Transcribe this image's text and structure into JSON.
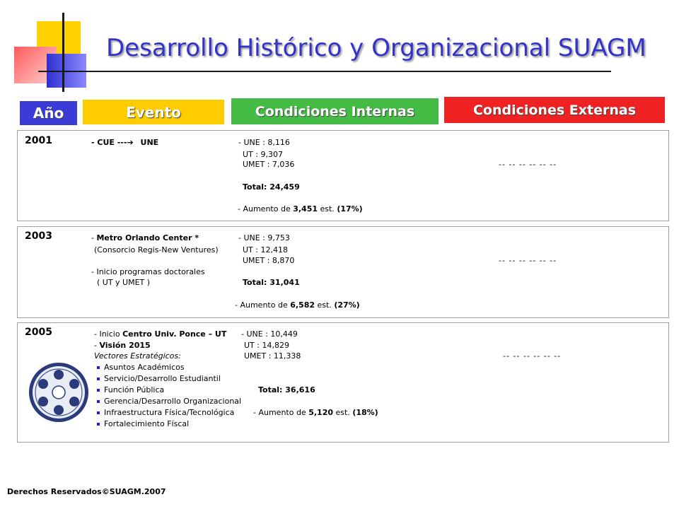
{
  "title": "Desarrollo Histórico y Organizacional SUAGM",
  "headers": {
    "year": "Año",
    "event": "Evento",
    "internal": "Condiciones Internas",
    "external": "Condiciones Externas"
  },
  "rows": [
    {
      "year": "2001",
      "event_lines": [
        "- CUE  ---",
        "UNE"
      ],
      "stats": [
        "- UNE :       8,116",
        "UT   :      9,307",
        "UMET :     7,036"
      ],
      "total": "Total:   24,459",
      "increase": {
        "prefix": "- Aumento de ",
        "value": "3,451",
        "suffix": " est. ",
        "pct": "(17%)"
      },
      "external": "--  --  --  --  --  --"
    },
    {
      "year": "2003",
      "event_lines": [
        "- ",
        "Metro Orlando Center *",
        "(Consorcio Regis-New Ventures)",
        "- Inicio programas doctorales",
        "( UT y UMET )"
      ],
      "stats": [
        "- UNE :        9,753",
        "UT   :     12,418",
        "UMET :       8,870"
      ],
      "total": "Total:    31,041",
      "increase": {
        "prefix": "- Aumento de ",
        "value": "6,582",
        "suffix": " est. ",
        "pct": "(27%)"
      },
      "external": "--  --  --  --  --  --"
    },
    {
      "year": "2005",
      "event_lines": [
        "- Inicio ",
        "Centro Univ. Ponce – UT",
        "- ",
        "Visión 2015",
        "Vectores Estratégicos:"
      ],
      "vectors": [
        "Asuntos Académicos",
        "Servicio/Desarrollo Estudiantil",
        "Función Pública",
        "Gerencia/Desarrollo Organizacional",
        "Infraestructura Física/Tecnológica",
        "Fortalecimiento Físcal"
      ],
      "stats": [
        "- UNE :       10,449",
        "UT   :      14,829",
        "UMET :     11,338"
      ],
      "total": "Total:    36,616",
      "increase": {
        "prefix": "- Aumento de ",
        "value": "5,120",
        "suffix": " est. ",
        "pct": "(18%)"
      },
      "external": "--  --  --  --  --  --"
    }
  ],
  "footer": "Derechos Reservados©SUAGM.2007",
  "colors": {
    "title": "#3333cc",
    "year_tab": "#3b3bd8",
    "event_tab": "#ffcc00",
    "internal_tab": "#44bb44",
    "external_tab": "#ee2222"
  }
}
